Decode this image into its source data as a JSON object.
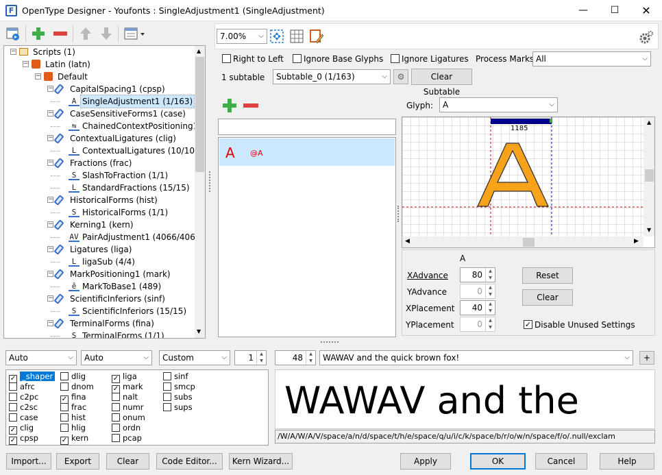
{
  "window": {
    "title": "OpenType Designer - Youfonts : SingleAdjustment1 (SingleAdjustment)",
    "app_icon": "F"
  },
  "tree": {
    "rows": [
      {
        "label": "Scripts (1)",
        "icon": "folder-icon"
      },
      {
        "label": "Latin (latn)",
        "icon": "language-icon"
      },
      {
        "label": "Default",
        "icon": "language-icon"
      },
      {
        "label": "CapitalSpacing1 (cpsp)",
        "icon": "feature-icon"
      },
      {
        "label": "SingleAdjustment1 (1/163)",
        "icon": "glyph-a-icon",
        "glyph": "A"
      },
      {
        "label": "CaseSensitiveForms1 (case)",
        "icon": "feature-icon"
      },
      {
        "label": "ChainedContextPositioning1",
        "icon": "chain-icon",
        "glyph": "⇆"
      },
      {
        "label": "ContextualLigatures (clig)",
        "icon": "feature-icon"
      },
      {
        "label": "ContextualLigatures (10/10)",
        "icon": "lookup-icon",
        "glyph": "L"
      },
      {
        "label": "Fractions (frac)",
        "icon": "feature-icon"
      },
      {
        "label": "SlashToFraction (1/1)",
        "icon": "lookup-icon",
        "glyph": "S"
      },
      {
        "label": "StandardFractions (15/15)",
        "icon": "lookup-icon",
        "glyph": "L"
      },
      {
        "label": "HistoricalForms (hist)",
        "icon": "feature-icon"
      },
      {
        "label": "HistoricalForms (1/1)",
        "icon": "lookup-icon",
        "glyph": "S"
      },
      {
        "label": "Kerning1 (kern)",
        "icon": "feature-icon"
      },
      {
        "label": "PairAdjustment1 (4066/4066)",
        "icon": "kern-icon",
        "glyph": "AV"
      },
      {
        "label": "Ligatures (liga)",
        "icon": "feature-icon"
      },
      {
        "label": "ligaSub (4/4)",
        "icon": "lookup-icon",
        "glyph": "L"
      },
      {
        "label": "MarkPositioning1 (mark)",
        "icon": "feature-icon"
      },
      {
        "label": "MarkToBase1 (489)",
        "icon": "mark-icon",
        "glyph": "ê"
      },
      {
        "label": "ScientificInferiors (sinf)",
        "icon": "feature-icon"
      },
      {
        "label": "ScientificInferiors (15/15)",
        "icon": "lookup-icon",
        "glyph": "S"
      },
      {
        "label": "TerminalForms (fina)",
        "icon": "feature-icon"
      },
      {
        "label": "TerminalForms (1/1)",
        "icon": "lookup-icon",
        "glyph": "S"
      }
    ]
  },
  "toolbar": {
    "zoom": "7.00%"
  },
  "options": {
    "right_to_left": "Right to Left",
    "ignore_base": "Ignore Base Glyphs",
    "ignore_ligatures": "Ignore Ligatures",
    "process_marks_label": "Process Marks:",
    "process_marks_value": "All",
    "subtable_count": "1 subtable",
    "subtable_value": "Subtable_0 (1/163)",
    "clear_subtable": "Clear Subtable"
  },
  "list": {
    "glyph": "A",
    "name": "@A"
  },
  "glyph_view": {
    "label": "Glyph:",
    "value": "A",
    "advance_label": "1185"
  },
  "values": {
    "header": "A",
    "xadvance_label": "XAdvance",
    "xadvance": "80",
    "yadvance_label": "YAdvance",
    "yadvance": "0",
    "xplacement_label": "XPlacement",
    "xplacement": "40",
    "yplacement_label": "YPlacement",
    "yplacement": "0",
    "reset": "Reset",
    "clear": "Clear",
    "disable_unused": "Disable Unused Settings"
  },
  "preview": {
    "script_combo": "Auto",
    "lang_combo": "Auto",
    "mode_combo": "Custom",
    "count": "1",
    "size": "48",
    "text": "WAWAV and the quick brown fox!",
    "plus": "+",
    "render": "WAWAV and the",
    "glyph_string": "/W/A/W/A/V/space/a/n/d/space/t/h/e/space/q/u/i/c/k/space/b/r/o/w/n/space/f/o/.null/exclam"
  },
  "features": [
    {
      "tag": "_shaper",
      "checked": true
    },
    {
      "tag": "afrc",
      "checked": false
    },
    {
      "tag": "c2pc",
      "checked": false
    },
    {
      "tag": "c2sc",
      "checked": false
    },
    {
      "tag": "case",
      "checked": false
    },
    {
      "tag": "clig",
      "checked": true
    },
    {
      "tag": "cpsp",
      "checked": true
    },
    {
      "tag": "dlig",
      "checked": false
    },
    {
      "tag": "dnom",
      "checked": false
    },
    {
      "tag": "fina",
      "checked": true
    },
    {
      "tag": "frac",
      "checked": false
    },
    {
      "tag": "hist",
      "checked": false
    },
    {
      "tag": "hlig",
      "checked": false
    },
    {
      "tag": "kern",
      "checked": true
    },
    {
      "tag": "liga",
      "checked": true
    },
    {
      "tag": "mark",
      "checked": true
    },
    {
      "tag": "nalt",
      "checked": false
    },
    {
      "tag": "numr",
      "checked": false
    },
    {
      "tag": "onum",
      "checked": false
    },
    {
      "tag": "ordn",
      "checked": false
    },
    {
      "tag": "pcap",
      "checked": false
    },
    {
      "tag": "sinf",
      "checked": false
    },
    {
      "tag": "smcp",
      "checked": false
    },
    {
      "tag": "subs",
      "checked": false
    },
    {
      "tag": "sups",
      "checked": false
    }
  ],
  "buttons": {
    "import": "Import...",
    "export": "Export",
    "clear": "Clear",
    "code_editor": "Code Editor...",
    "kern_wizard": "Kern Wizard...",
    "apply": "Apply",
    "ok": "OK",
    "cancel": "Cancel",
    "help": "Help"
  },
  "colors": {
    "accent": "#0078d7",
    "glyph_fill": "#f7a21b",
    "advance_bar": "#00008b",
    "red_text": "#e00000"
  }
}
